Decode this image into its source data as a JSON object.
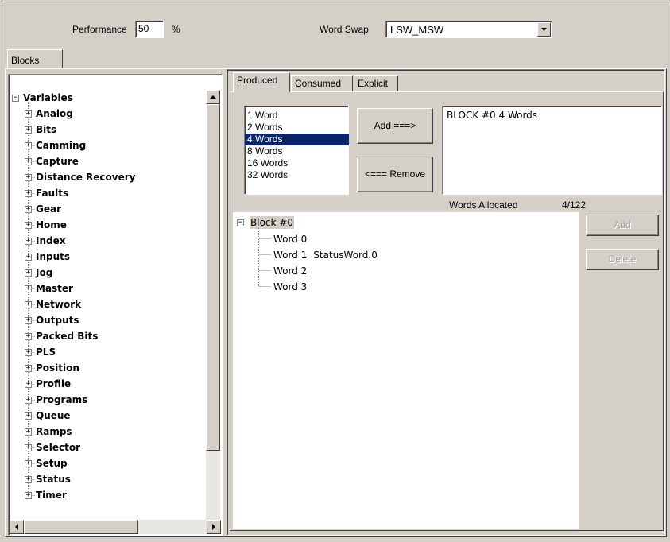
{
  "top": {
    "performance_label": "Performance",
    "performance_value": "50",
    "performance_unit": "%",
    "word_swap_label": "Word Swap",
    "word_swap_value": "LSW_MSW"
  },
  "blocks_tab": "Blocks",
  "tree": {
    "root": "Variables",
    "items": [
      "Analog",
      "Bits",
      "Camming",
      "Capture",
      "Distance Recovery",
      "Faults",
      "Gear",
      "Home",
      "Index",
      "Inputs",
      "Jog",
      "Master",
      "Network",
      "Outputs",
      "Packed Bits",
      "PLS",
      "Position",
      "Profile",
      "Programs",
      "Queue",
      "Ramps",
      "Selector",
      "Setup",
      "Status",
      "Timer"
    ]
  },
  "tabs": [
    "Produced",
    "Consumed",
    "Explicit"
  ],
  "word_list": {
    "items": [
      "1 Word",
      "2 Words",
      "4 Words",
      "8 Words",
      "16 Words",
      "32 Words"
    ],
    "selected_index": 2
  },
  "buttons": {
    "add_arrow": "Add ===>",
    "remove_arrow": "<=== Remove",
    "add": "Add",
    "delete": "Delete"
  },
  "block_list": [
    "BLOCK #0  4 Words"
  ],
  "words_allocated": {
    "label": "Words Allocated",
    "value": "4/122"
  },
  "block_tree": {
    "root": "Block #0",
    "words": [
      {
        "name": "Word 0",
        "value": ""
      },
      {
        "name": "Word 1",
        "value": "StatusWord.0"
      },
      {
        "name": "Word 2",
        "value": ""
      },
      {
        "name": "Word 3",
        "value": ""
      }
    ]
  },
  "icons": [
    "expand-icon",
    "collapse-icon",
    "dropdown-arrow-icon",
    "scroll-up-icon",
    "scroll-down-icon",
    "scroll-left-icon",
    "scroll-right-icon"
  ]
}
